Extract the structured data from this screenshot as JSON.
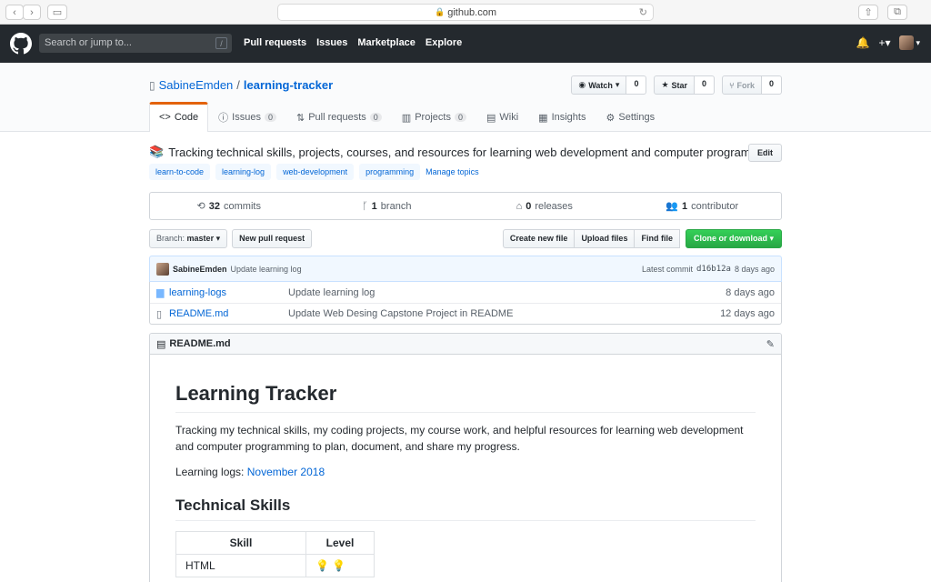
{
  "browser": {
    "url": "github.com"
  },
  "header": {
    "search_placeholder": "Search or jump to...",
    "search_key": "/",
    "nav": [
      "Pull requests",
      "Issues",
      "Marketplace",
      "Explore"
    ]
  },
  "repo": {
    "owner": "SabineEmden",
    "separator": "/",
    "name": "learning-tracker",
    "watch": {
      "label": "Watch",
      "count": "0"
    },
    "star": {
      "label": "Star",
      "count": "0"
    },
    "fork": {
      "label": "Fork",
      "count": "0"
    },
    "tabs": [
      {
        "label": "Code",
        "icon": "code-icon",
        "count": null
      },
      {
        "label": "Issues",
        "icon": "issue-icon",
        "count": "0"
      },
      {
        "label": "Pull requests",
        "icon": "pull-request-icon",
        "count": "0"
      },
      {
        "label": "Projects",
        "icon": "project-icon",
        "count": "0"
      },
      {
        "label": "Wiki",
        "icon": "wiki-icon",
        "count": null
      },
      {
        "label": "Insights",
        "icon": "graph-icon",
        "count": null
      },
      {
        "label": "Settings",
        "icon": "gear-icon",
        "count": null
      }
    ],
    "description": "Tracking technical skills, projects, courses, and resources for learning web development and computer programming",
    "edit_label": "Edit",
    "topics": [
      "learn-to-code",
      "learning-log",
      "web-development",
      "programming"
    ],
    "manage_topics": "Manage topics",
    "summary": {
      "commits_num": "32",
      "commits_label": "commits",
      "branch_num": "1",
      "branch_label": "branch",
      "releases_num": "0",
      "releases_label": "releases",
      "contributor_num": "1",
      "contributor_label": "contributor"
    },
    "branch_label": "Branch:",
    "branch_value": "master",
    "new_pr": "New pull request",
    "create_file": "Create new file",
    "upload_files": "Upload files",
    "find_file": "Find file",
    "clone": "Clone or download",
    "latest_commit": {
      "author": "SabineEmden",
      "message": "Update learning log",
      "latest_label": "Latest commit",
      "sha": "d16b12a",
      "age": "8 days ago"
    },
    "files": [
      {
        "type": "folder",
        "name": "learning-logs",
        "commit": "Update learning log",
        "age": "8 days ago"
      },
      {
        "type": "file",
        "name": "README.md",
        "commit": "Update Web Desing Capstone Project in README",
        "age": "12 days ago"
      }
    ]
  },
  "readme": {
    "filename": "README.md",
    "title": "Learning Tracker",
    "intro": "Tracking my technical skills, my coding projects, my course work, and helpful resources for learning web development and computer programming to plan, document, and share my progress.",
    "logs_label": "Learning logs:",
    "logs_link": "November 2018",
    "section": "Technical Skills",
    "table_headers": [
      "Skill",
      "Level"
    ],
    "rows": [
      {
        "skill": "HTML",
        "level": "💡 💡"
      }
    ]
  }
}
